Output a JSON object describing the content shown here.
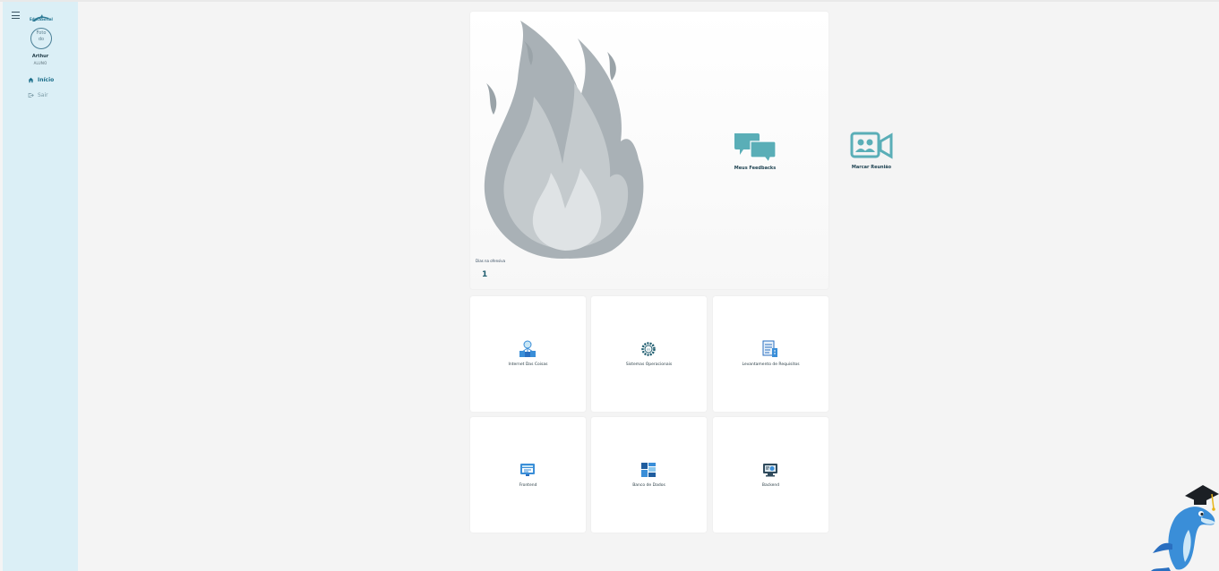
{
  "sidebar": {
    "brand_text": "EducaSoftal",
    "avatar_alt": "Foto do",
    "user_name": "Arthur",
    "user_role": "ALUNO",
    "nav": [
      {
        "label": "Início",
        "icon": "home-icon",
        "active": true
      },
      {
        "label": "Sair",
        "icon": "logout-icon",
        "active": false
      }
    ]
  },
  "streak": {
    "label": "Dias na ofensiva",
    "value": "1",
    "icon": "flame-icon"
  },
  "quick_actions": [
    {
      "label": "Meus Feedbacks",
      "icon": "chat-bubbles-icon"
    },
    {
      "label": "Marcar Reunião",
      "icon": "video-call-icon"
    }
  ],
  "modules": [
    {
      "label": "Internet Das Coisas",
      "icon": "network-icon"
    },
    {
      "label": "Sistemas Operacionais",
      "icon": "os-gear-icon"
    },
    {
      "label": "Levantamento de Requisitos",
      "icon": "requirements-document-icon"
    },
    {
      "label": "Frontend",
      "icon": "frontend-monitor-icon"
    },
    {
      "label": "Banco de Dados",
      "icon": "database-blocks-icon"
    },
    {
      "label": "Backend",
      "icon": "backend-monitor-icon"
    }
  ],
  "colors": {
    "sidebar_bg": "#dbeff6",
    "accent": "#5aaeb7",
    "page_bg": "#f4f4f4"
  }
}
